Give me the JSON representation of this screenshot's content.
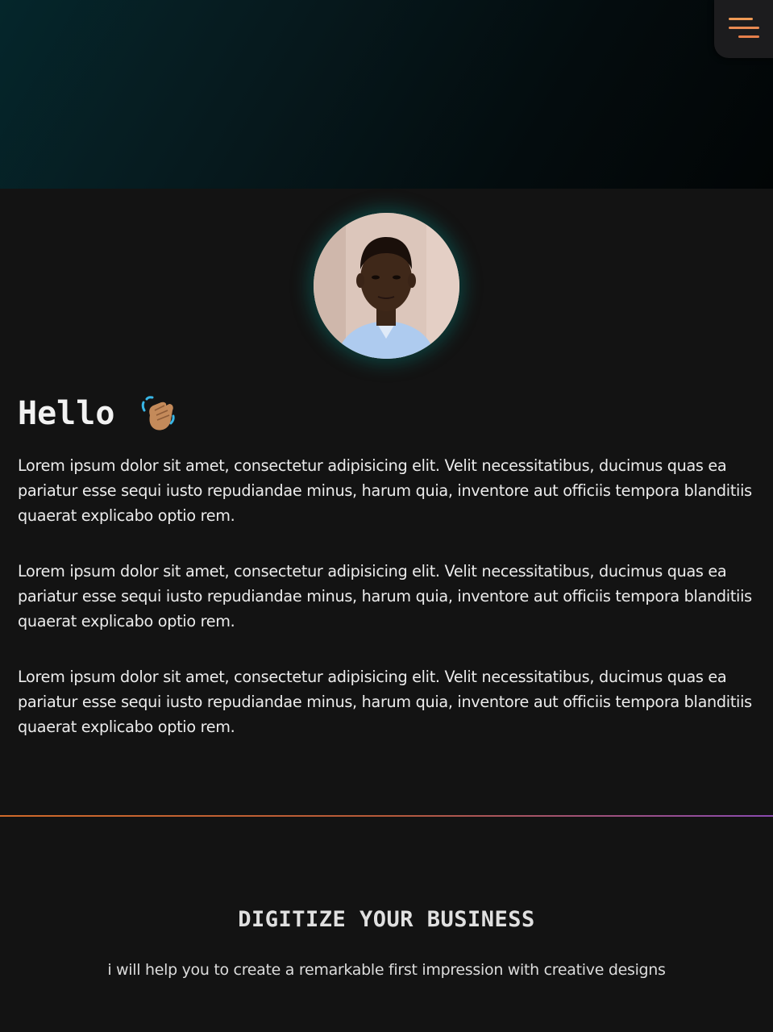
{
  "header": {
    "menu_icon": "hamburger-menu-icon",
    "menu_colors": [
      "#ef9a55",
      "#e98a52",
      "#e67f4b"
    ]
  },
  "profile": {
    "avatar_icon": "profile-photo"
  },
  "about": {
    "greeting": "Hello",
    "greeting_icon": "waving-hand-icon",
    "paragraphs": [
      "Lorem ipsum dolor sit amet, consectetur adipisicing elit. Velit necessitatibus, ducimus quas ea pariatur esse sequi iusto repudiandae minus, harum quia, inventore aut officiis tempora blanditiis quaerat explicabo optio rem.",
      "Lorem ipsum dolor sit amet, consectetur adipisicing elit. Velit necessitatibus, ducimus quas ea pariatur esse sequi iusto repudiandae minus, harum quia, inventore aut officiis tempora blanditiis quaerat explicabo optio rem.",
      "Lorem ipsum dolor sit amet, consectetur adipisicing elit. Velit necessitatibus, ducimus quas ea pariatur esse sequi iusto repudiandae minus, harum quia, inventore aut officiis tempora blanditiis quaerat explicabo optio rem."
    ]
  },
  "cta": {
    "title": "DIGITIZE YOUR BUSINESS",
    "subtitle": "i will help you to create a remarkable first impression with creative designs"
  },
  "colors": {
    "background": "#131313",
    "accent_orange": "#d06a2a",
    "accent_purple": "#8a4ab0",
    "glow_teal": "#00968c"
  }
}
